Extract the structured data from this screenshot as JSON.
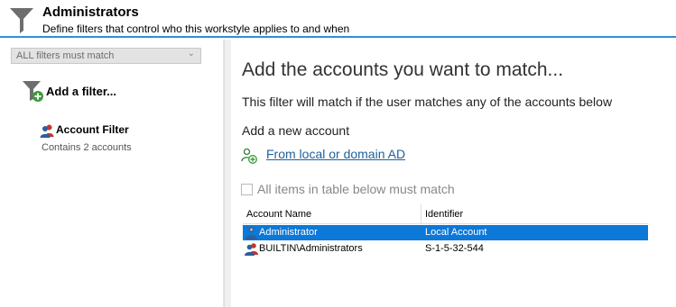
{
  "header": {
    "title": "Administrators",
    "subtitle": "Define filters that control who this workstyle applies to and when",
    "icon": "funnel-icon",
    "accent_color": "#2f8fd8"
  },
  "sidebar": {
    "match_select": {
      "value": "ALL filters must match",
      "icon": "chevron-down-icon"
    },
    "add_filter": {
      "label": "Add a filter...",
      "icon": "add-filter-icon"
    },
    "filters": [
      {
        "label": "Account Filter",
        "sublabel": "Contains 2 accounts",
        "icon": "users-icon"
      }
    ]
  },
  "main": {
    "heading": "Add the accounts you want to match...",
    "description": "This filter will match if the user matches any of the accounts below",
    "add_new_label": "Add a new account",
    "from_ad_link": "From local or domain AD",
    "from_ad_icon": "add-user-icon",
    "all_items_checkbox": {
      "label": "All items in table below must match",
      "checked": false
    },
    "table": {
      "columns": [
        "Account Name",
        "Identifier"
      ],
      "rows": [
        {
          "name": "Administrator",
          "identifier": "Local Account",
          "selected": true,
          "icon": "user-icon"
        },
        {
          "name": "BUILTIN\\Administrators",
          "identifier": "S-1-5-32-544",
          "selected": false,
          "icon": "users-icon"
        }
      ],
      "selection_color": "#0c78d7"
    }
  }
}
